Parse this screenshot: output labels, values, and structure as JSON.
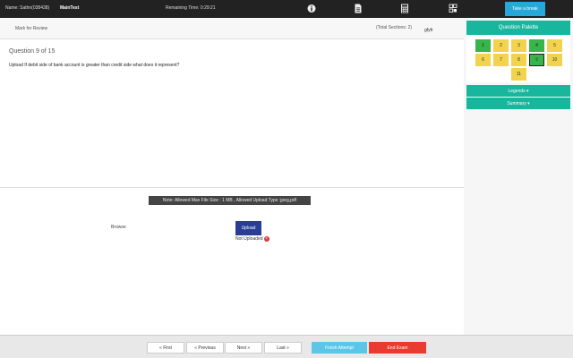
{
  "topbar": {
    "name": "Name: Sathn(038438)",
    "test": "MainTest",
    "remaining": "Remaining Time:  0:29:21",
    "icons": [
      "info-icon",
      "document-icon",
      "calculator-icon",
      "grid-icon"
    ],
    "break_label": "Take a break"
  },
  "subheader": {
    "mark_label": "Mark for Review",
    "sections": "(Total Sections: 2)",
    "extra": "gfyfr"
  },
  "question": {
    "number": "Question 9 of 15",
    "text": "Upload If debit side of bank account is greater than credit side what does it represent?"
  },
  "upload": {
    "note": "Note: Allowed Max File Size : 1 MB , Allowed Upload Type :jpeg,pdf",
    "browse_label": "Browse",
    "upload_label": "Upload",
    "status": "Not Uploaded"
  },
  "palette": {
    "title": "Question Palette",
    "questions": [
      {
        "label": "1",
        "state": "answered"
      },
      {
        "label": "2",
        "state": "notvisited"
      },
      {
        "label": "3",
        "state": "notvisited"
      },
      {
        "label": "4",
        "state": "answered"
      },
      {
        "label": "5",
        "state": "notvisited"
      },
      {
        "label": "6",
        "state": "notvisited"
      },
      {
        "label": "7",
        "state": "notvisited"
      },
      {
        "label": "8",
        "state": "notvisited"
      },
      {
        "label": "9",
        "state": "current"
      },
      {
        "label": "10",
        "state": "notvisited"
      },
      {
        "label": "11",
        "state": "notvisited"
      }
    ],
    "legends_label": "Legends",
    "summary_label": "Summary"
  },
  "footer": {
    "first": "« First",
    "previous": "« Previous",
    "next": "Next »",
    "last": "Last »",
    "submit": "Finish Attempt",
    "end": "End Exam"
  },
  "colors": {
    "accent": "#19b69e",
    "answered": "#37b44a",
    "notvisited": "#f2d34d",
    "end": "#e93b2f"
  }
}
